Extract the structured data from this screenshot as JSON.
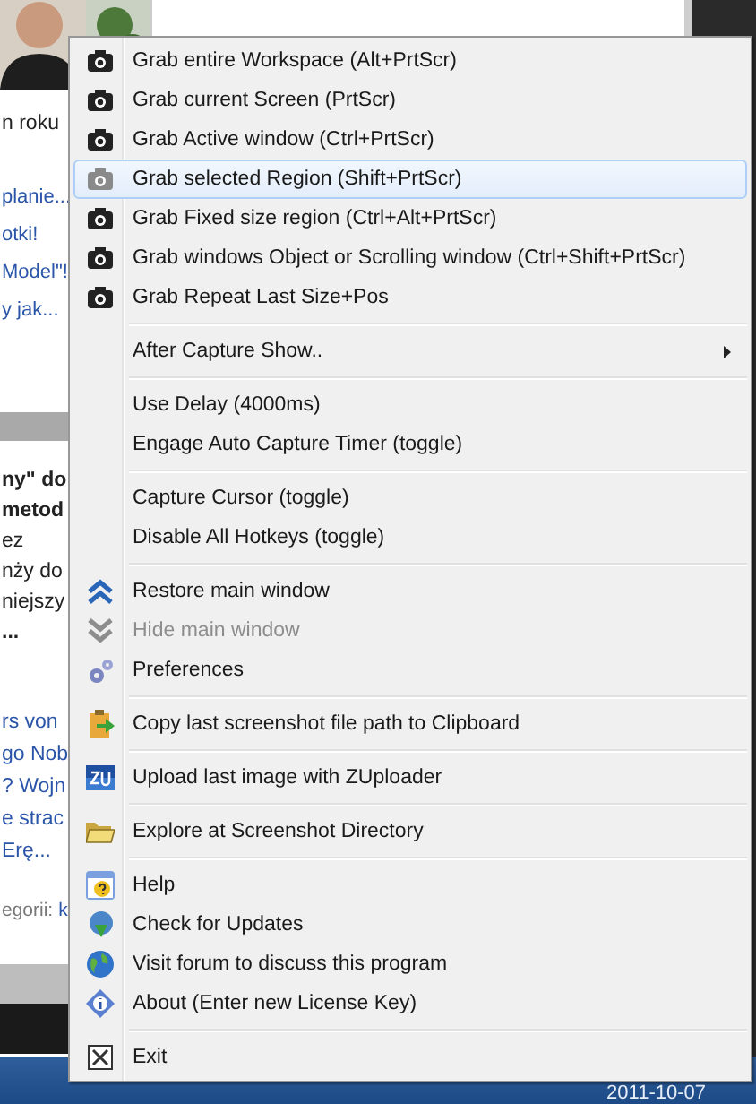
{
  "background_page": {
    "top_text": "n roku",
    "links_1": [
      "planie...",
      "otki!",
      "Model\"!",
      "y jak..."
    ],
    "article": [
      {
        "text": "ny\" do",
        "bold": true
      },
      {
        "text": "metod",
        "bold": true
      },
      {
        "text": "ez",
        "bold": false
      },
      {
        "text": "nży do",
        "bold": false
      },
      {
        "text": "niejszy",
        "bold": false
      },
      {
        "text": "...",
        "bold": true
      }
    ],
    "links_2": [
      "rs von",
      "go Nob",
      "? Wojn",
      "e strac",
      "Erę..."
    ],
    "category_label": "egorii:",
    "category_link": "k"
  },
  "taskbar": {
    "date": "2011-10-07"
  },
  "menu": {
    "groups": [
      [
        {
          "label": "Grab entire Workspace (Alt+PrtScr)",
          "selected": false,
          "disabled": false,
          "submenu": false
        },
        {
          "label": "Grab current Screen (PrtScr)",
          "selected": false,
          "disabled": false,
          "submenu": false
        },
        {
          "label": "Grab Active window (Ctrl+PrtScr)",
          "selected": false,
          "disabled": false,
          "submenu": false
        },
        {
          "label": "Grab selected Region (Shift+PrtScr)",
          "selected": true,
          "disabled": false,
          "submenu": false
        },
        {
          "label": "Grab Fixed size region (Ctrl+Alt+PrtScr)",
          "selected": false,
          "disabled": false,
          "submenu": false
        },
        {
          "label": "Grab windows Object or Scrolling window (Ctrl+Shift+PrtScr)",
          "selected": false,
          "disabled": false,
          "submenu": false
        },
        {
          "label": "Grab Repeat Last Size+Pos",
          "selected": false,
          "disabled": false,
          "submenu": false
        }
      ],
      [
        {
          "label": "After Capture Show..",
          "selected": false,
          "disabled": false,
          "submenu": true
        }
      ],
      [
        {
          "label": "Use Delay (4000ms)",
          "selected": false,
          "disabled": false,
          "submenu": false
        },
        {
          "label": "Engage Auto Capture Timer (toggle)",
          "selected": false,
          "disabled": false,
          "submenu": false
        }
      ],
      [
        {
          "label": "Capture Cursor (toggle)",
          "selected": false,
          "disabled": false,
          "submenu": false
        },
        {
          "label": "Disable All Hotkeys (toggle)",
          "selected": false,
          "disabled": false,
          "submenu": false
        }
      ],
      [
        {
          "label": "Restore main window",
          "selected": false,
          "disabled": false,
          "submenu": false
        },
        {
          "label": "Hide main window",
          "selected": false,
          "disabled": true,
          "submenu": false
        },
        {
          "label": "Preferences",
          "selected": false,
          "disabled": false,
          "submenu": false
        }
      ],
      [
        {
          "label": "Copy last screenshot file path to Clipboard",
          "selected": false,
          "disabled": false,
          "submenu": false
        }
      ],
      [
        {
          "label": "Upload last image with ZUploader",
          "selected": false,
          "disabled": false,
          "submenu": false
        }
      ],
      [
        {
          "label": "Explore at Screenshot Directory",
          "selected": false,
          "disabled": false,
          "submenu": false
        }
      ],
      [
        {
          "label": "Help",
          "selected": false,
          "disabled": false,
          "submenu": false
        },
        {
          "label": "Check for Updates",
          "selected": false,
          "disabled": false,
          "submenu": false
        },
        {
          "label": "Visit forum to discuss this program",
          "selected": false,
          "disabled": false,
          "submenu": false
        },
        {
          "label": "About (Enter new License Key)",
          "selected": false,
          "disabled": false,
          "submenu": false
        }
      ],
      [
        {
          "label": "Exit",
          "selected": false,
          "disabled": false,
          "submenu": false
        }
      ]
    ]
  }
}
